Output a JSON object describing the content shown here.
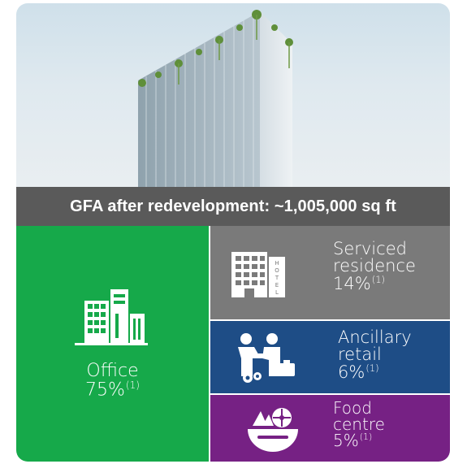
{
  "banner": {
    "title": "GFA after redevelopment: ~1,005,000 sq ft"
  },
  "tiles": {
    "office": {
      "name": "Office",
      "percent": "75%",
      "note": "(1)",
      "color": "#16a94a",
      "icon": "office-buildings-icon"
    },
    "serviced": {
      "name_line1": "Serviced",
      "name_line2": "residence",
      "percent": "14%",
      "note": "(1)",
      "color": "#7a7a7a",
      "icon": "hotel-icon",
      "icon_text": "HOTEL"
    },
    "retail": {
      "name_line1": "Ancillary",
      "name_line2": "retail",
      "percent": "6%",
      "note": "(1)",
      "color": "#1e4d86",
      "icon": "handshake-icon"
    },
    "food": {
      "name_line1": "Food",
      "name_line2": "centre",
      "percent": "5%",
      "note": "(1)",
      "color": "#762184",
      "icon": "food-bowl-icon"
    }
  },
  "colors": {
    "banner_bg": "#5a5a5a",
    "text": "#ffffff"
  }
}
